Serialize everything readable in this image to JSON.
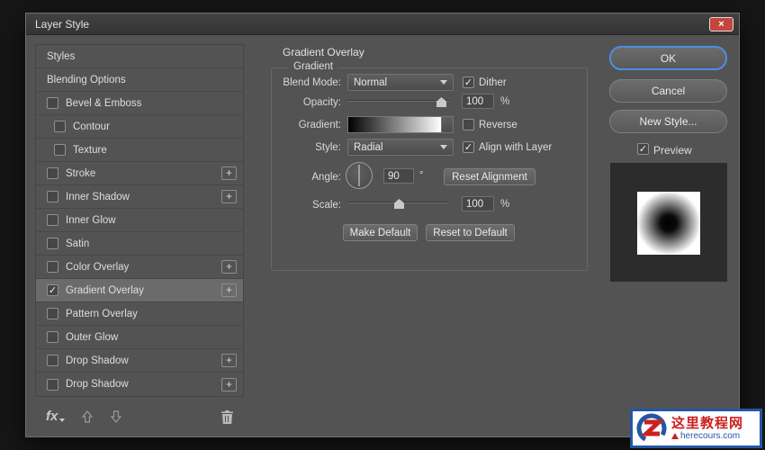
{
  "window": {
    "title": "Layer Style",
    "close_glyph": "×"
  },
  "colors": {
    "accent_blue": "#4a8fe2",
    "close_red": "#c4453d",
    "selected_row": "#6b6b6b",
    "watermark_blue": "#2456a5",
    "watermark_red": "#cc2020"
  },
  "icons": {
    "check": "✓",
    "plus": "+"
  },
  "sidebar": {
    "items": [
      {
        "label": "Styles",
        "checkbox": false,
        "checked": false,
        "indent": false,
        "plus": false,
        "selected": false
      },
      {
        "label": "Blending Options",
        "checkbox": false,
        "checked": false,
        "indent": false,
        "plus": false,
        "selected": false
      },
      {
        "label": "Bevel & Emboss",
        "checkbox": true,
        "checked": false,
        "indent": false,
        "plus": false,
        "selected": false
      },
      {
        "label": "Contour",
        "checkbox": true,
        "checked": false,
        "indent": true,
        "plus": false,
        "selected": false
      },
      {
        "label": "Texture",
        "checkbox": true,
        "checked": false,
        "indent": true,
        "plus": false,
        "selected": false
      },
      {
        "label": "Stroke",
        "checkbox": true,
        "checked": false,
        "indent": false,
        "plus": true,
        "selected": false
      },
      {
        "label": "Inner Shadow",
        "checkbox": true,
        "checked": false,
        "indent": false,
        "plus": true,
        "selected": false
      },
      {
        "label": "Inner Glow",
        "checkbox": true,
        "checked": false,
        "indent": false,
        "plus": false,
        "selected": false
      },
      {
        "label": "Satin",
        "checkbox": true,
        "checked": false,
        "indent": false,
        "plus": false,
        "selected": false
      },
      {
        "label": "Color Overlay",
        "checkbox": true,
        "checked": false,
        "indent": false,
        "plus": true,
        "selected": false
      },
      {
        "label": "Gradient Overlay",
        "checkbox": true,
        "checked": true,
        "indent": false,
        "plus": true,
        "selected": true
      },
      {
        "label": "Pattern Overlay",
        "checkbox": true,
        "checked": false,
        "indent": false,
        "plus": false,
        "selected": false
      },
      {
        "label": "Outer Glow",
        "checkbox": true,
        "checked": false,
        "indent": false,
        "plus": false,
        "selected": false
      },
      {
        "label": "Drop Shadow",
        "checkbox": true,
        "checked": false,
        "indent": false,
        "plus": true,
        "selected": false
      },
      {
        "label": "Drop Shadow",
        "checkbox": true,
        "checked": false,
        "indent": false,
        "plus": true,
        "selected": false
      }
    ],
    "footer": {
      "fx_label": "fx"
    }
  },
  "main": {
    "heading": "Gradient Overlay",
    "group_label": "Gradient",
    "blend_mode_label": "Blend Mode:",
    "blend_mode_value": "Normal",
    "dither_label": "Dither",
    "dither_checked": true,
    "opacity_label": "Opacity:",
    "opacity_value": "100",
    "opacity_unit": "%",
    "gradient_label": "Gradient:",
    "gradient_css": "linear-gradient(to right, #000000, #ffffff)",
    "reverse_label": "Reverse",
    "reverse_checked": false,
    "style_label": "Style:",
    "style_value": "Radial",
    "align_label": "Align with Layer",
    "align_checked": true,
    "angle_label": "Angle:",
    "angle_value": "90",
    "angle_unit": "°",
    "reset_alignment_label": "Reset Alignment",
    "scale_label": "Scale:",
    "scale_value": "100",
    "scale_unit": "%",
    "make_default_label": "Make Default",
    "reset_default_label": "Reset to Default"
  },
  "actions": {
    "ok": "OK",
    "cancel": "Cancel",
    "new_style": "New Style...",
    "preview_label": "Preview",
    "preview_checked": true,
    "preview_thumb_css": "radial-gradient(circle at 50% 50%, #000000 0%, #0a0a0a 18%, #ffffff 72%)"
  },
  "watermark": {
    "title": "这里教程网",
    "subtitle": "herecours.com"
  }
}
